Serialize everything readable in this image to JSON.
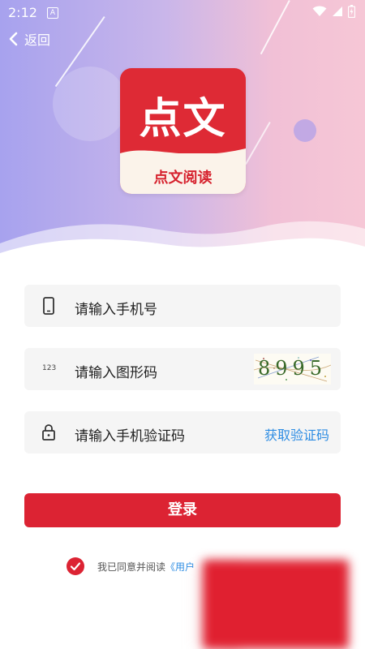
{
  "status_bar": {
    "time": "2:12",
    "badge": "A",
    "icons": [
      "wifi-icon",
      "signal-icon",
      "battery-icon"
    ]
  },
  "nav": {
    "back_label": "返回"
  },
  "logo": {
    "main_text": "点文",
    "sub_text": "点文阅读"
  },
  "form": {
    "phone_placeholder": "请输入手机号",
    "captcha_placeholder": "请输入图形码",
    "captcha_icon_text": "123",
    "captcha_code": "8995",
    "sms_placeholder": "请输入手机验证码",
    "get_code_label": "获取验证码"
  },
  "login": {
    "button_label": "登录"
  },
  "agreement": {
    "text": "我已同意并阅读",
    "link_text": "《用户"
  },
  "colors": {
    "primary": "#dc2333",
    "link": "#2e8de3",
    "field_bg": "#f5f5f5"
  }
}
